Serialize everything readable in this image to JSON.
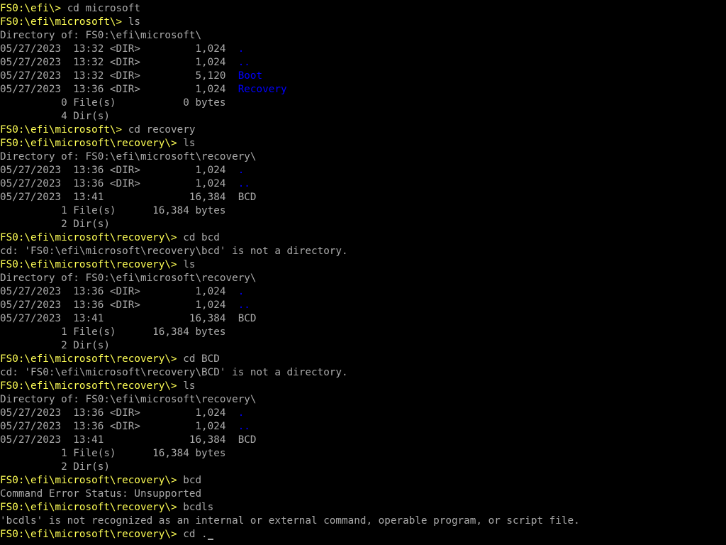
{
  "colors": {
    "background": "#000000",
    "text": "#aaaaaa",
    "prompt": "#ffff55",
    "directory": "#0000ff"
  },
  "lines": [
    {
      "type": "prompt",
      "prompt": "FS0:\\efi\\> ",
      "command": "cd microsoft"
    },
    {
      "type": "prompt",
      "prompt": "FS0:\\efi\\microsoft\\> ",
      "command": "ls"
    },
    {
      "type": "text",
      "text": "Directory of: FS0:\\efi\\microsoft\\"
    },
    {
      "type": "entry",
      "info": "05/27/2023  13:32 <DIR>         1,024  ",
      "name": ".",
      "is_dir": true
    },
    {
      "type": "entry",
      "info": "05/27/2023  13:32 <DIR>         1,024  ",
      "name": "..",
      "is_dir": true
    },
    {
      "type": "entry",
      "info": "05/27/2023  13:32 <DIR>         5,120  ",
      "name": "Boot",
      "is_dir": true
    },
    {
      "type": "entry",
      "info": "05/27/2023  13:36 <DIR>         1,024  ",
      "name": "Recovery",
      "is_dir": true
    },
    {
      "type": "text",
      "text": "          0 File(s)           0 bytes"
    },
    {
      "type": "text",
      "text": "          4 Dir(s)"
    },
    {
      "type": "prompt",
      "prompt": "FS0:\\efi\\microsoft\\> ",
      "command": "cd recovery"
    },
    {
      "type": "prompt",
      "prompt": "FS0:\\efi\\microsoft\\recovery\\> ",
      "command": "ls"
    },
    {
      "type": "text",
      "text": "Directory of: FS0:\\efi\\microsoft\\recovery\\"
    },
    {
      "type": "entry",
      "info": "05/27/2023  13:36 <DIR>         1,024  ",
      "name": ".",
      "is_dir": true
    },
    {
      "type": "entry",
      "info": "05/27/2023  13:36 <DIR>         1,024  ",
      "name": "..",
      "is_dir": true
    },
    {
      "type": "entry",
      "info": "05/27/2023  13:41              16,384  ",
      "name": "BCD",
      "is_dir": false
    },
    {
      "type": "text",
      "text": "          1 File(s)      16,384 bytes"
    },
    {
      "type": "text",
      "text": "          2 Dir(s)"
    },
    {
      "type": "prompt",
      "prompt": "FS0:\\efi\\microsoft\\recovery\\> ",
      "command": "cd bcd"
    },
    {
      "type": "text",
      "text": "cd: 'FS0:\\efi\\microsoft\\recovery\\bcd' is not a directory."
    },
    {
      "type": "prompt",
      "prompt": "FS0:\\efi\\microsoft\\recovery\\> ",
      "command": "ls"
    },
    {
      "type": "text",
      "text": "Directory of: FS0:\\efi\\microsoft\\recovery\\"
    },
    {
      "type": "entry",
      "info": "05/27/2023  13:36 <DIR>         1,024  ",
      "name": ".",
      "is_dir": true
    },
    {
      "type": "entry",
      "info": "05/27/2023  13:36 <DIR>         1,024  ",
      "name": "..",
      "is_dir": true
    },
    {
      "type": "entry",
      "info": "05/27/2023  13:41              16,384  ",
      "name": "BCD",
      "is_dir": false
    },
    {
      "type": "text",
      "text": "          1 File(s)      16,384 bytes"
    },
    {
      "type": "text",
      "text": "          2 Dir(s)"
    },
    {
      "type": "prompt",
      "prompt": "FS0:\\efi\\microsoft\\recovery\\> ",
      "command": "cd BCD"
    },
    {
      "type": "text",
      "text": "cd: 'FS0:\\efi\\microsoft\\recovery\\BCD' is not a directory."
    },
    {
      "type": "prompt",
      "prompt": "FS0:\\efi\\microsoft\\recovery\\> ",
      "command": "ls"
    },
    {
      "type": "text",
      "text": "Directory of: FS0:\\efi\\microsoft\\recovery\\"
    },
    {
      "type": "entry",
      "info": "05/27/2023  13:36 <DIR>         1,024  ",
      "name": ".",
      "is_dir": true
    },
    {
      "type": "entry",
      "info": "05/27/2023  13:36 <DIR>         1,024  ",
      "name": "..",
      "is_dir": true
    },
    {
      "type": "entry",
      "info": "05/27/2023  13:41              16,384  ",
      "name": "BCD",
      "is_dir": false
    },
    {
      "type": "text",
      "text": "          1 File(s)      16,384 bytes"
    },
    {
      "type": "text",
      "text": "          2 Dir(s)"
    },
    {
      "type": "prompt",
      "prompt": "FS0:\\efi\\microsoft\\recovery\\> ",
      "command": "bcd"
    },
    {
      "type": "text",
      "text": "Command Error Status: Unsupported"
    },
    {
      "type": "prompt",
      "prompt": "FS0:\\efi\\microsoft\\recovery\\> ",
      "command": "bcdls"
    },
    {
      "type": "text",
      "text": "'bcdls' is not recognized as an internal or external command, operable program, or script file."
    },
    {
      "type": "input",
      "prompt": "FS0:\\efi\\microsoft\\recovery\\> ",
      "command": "cd ."
    }
  ]
}
